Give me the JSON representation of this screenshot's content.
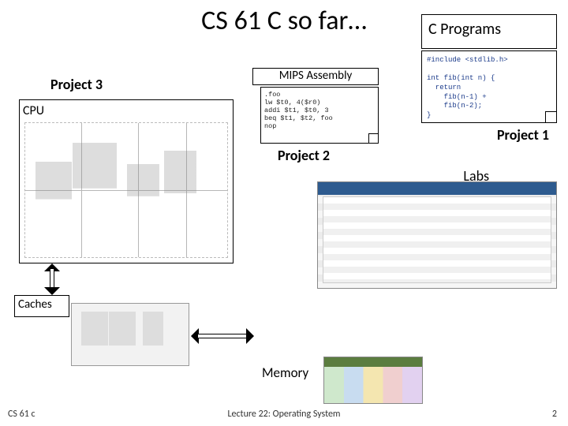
{
  "title": "CS 61 C so far…",
  "cprograms": {
    "label": "C Programs"
  },
  "c_code": "#include <stdlib.h>\n\nint fib(int n) {\n  return\n    fib(n-1) +\n    fib(n-2);\n}",
  "proj1": "Project 1",
  "labs": "Labs",
  "mips": {
    "label": "MIPS Assembly"
  },
  "mips_code": ".foo\nlw $t0, 4($r0)\naddi $t1, $t0, 3\nbeq $t1, $t2, foo\nnop",
  "proj2": "Project 2",
  "proj3": "Project 3",
  "cpu": {
    "label": "CPU"
  },
  "caches": {
    "label": "Caches"
  },
  "memory": {
    "label": "Memory"
  },
  "footer": {
    "left": "CS 61 c",
    "mid": "Lecture 22: Operating System",
    "right": "2"
  }
}
